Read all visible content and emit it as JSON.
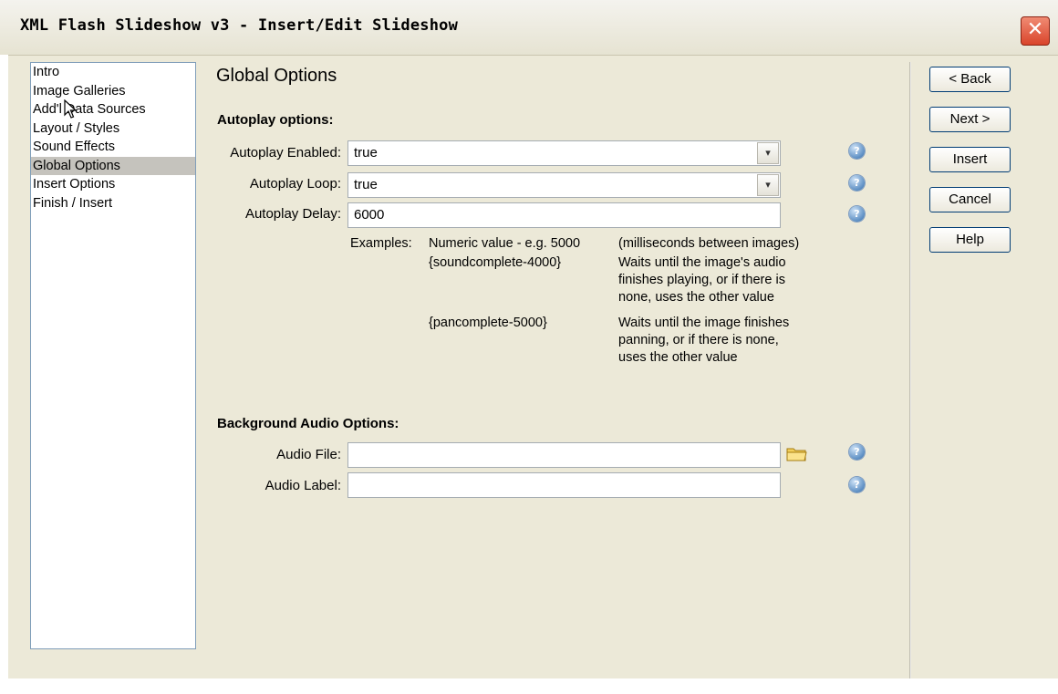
{
  "window": {
    "title": "XML Flash Slideshow v3 - Insert/Edit Slideshow",
    "close_label": "✕"
  },
  "nav": {
    "items": [
      {
        "label": "Intro"
      },
      {
        "label": "Image Galleries"
      },
      {
        "label": "Add'l Data Sources"
      },
      {
        "label": "Layout / Styles"
      },
      {
        "label": "Sound Effects"
      },
      {
        "label": "Global Options"
      },
      {
        "label": "Insert Options"
      },
      {
        "label": "Finish / Insert"
      }
    ],
    "selected": "Global Options"
  },
  "main": {
    "heading": "Global Options",
    "autoplay": {
      "section_title": "Autoplay options:",
      "enabled_label": "Autoplay Enabled:",
      "enabled_value": "true",
      "loop_label": "Autoplay Loop:",
      "loop_value": "true",
      "delay_label": "Autoplay Delay:",
      "delay_value": "6000",
      "examples_label": "Examples:",
      "examples": [
        {
          "value": "Numeric value - e.g. 5000",
          "desc": [
            "(milliseconds between images)"
          ]
        },
        {
          "value": "{soundcomplete-4000}",
          "desc": [
            "Waits until the image's audio",
            "finishes playing, or if there is",
            "none, uses the other value"
          ]
        },
        {
          "value": "{pancomplete-5000}",
          "desc": [
            "Waits until the image finishes",
            "panning, or if there is none,",
            "uses the other value"
          ]
        }
      ]
    },
    "audio": {
      "section_title": "Background Audio Options:",
      "file_label": "Audio File:",
      "file_value": "",
      "label_label": "Audio Label:",
      "label_value": ""
    }
  },
  "buttons": {
    "back": "< Back",
    "next": "Next >",
    "insert": "Insert",
    "cancel": "Cancel",
    "help": "Help"
  },
  "icons": {
    "help": "?",
    "dropdown": "▾"
  }
}
